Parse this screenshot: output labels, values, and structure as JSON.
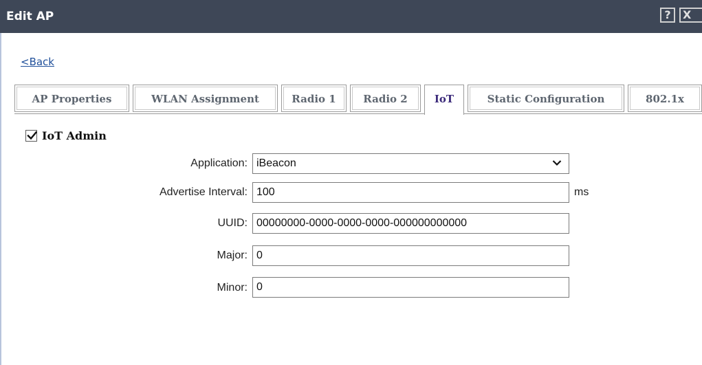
{
  "dialog": {
    "title": "Edit AP",
    "help_label": "?",
    "close_label": "X"
  },
  "back_link": "<Back",
  "tabs": [
    {
      "label": "AP Properties",
      "active": false
    },
    {
      "label": "WLAN Assignment",
      "active": false
    },
    {
      "label": "Radio 1",
      "active": false
    },
    {
      "label": "Radio 2",
      "active": false
    },
    {
      "label": "IoT",
      "active": true
    },
    {
      "label": "Static Configuration",
      "active": false
    },
    {
      "label": "802.1x",
      "active": false
    }
  ],
  "iot_admin": {
    "label": "IoT Admin",
    "checked": true
  },
  "form": {
    "application": {
      "label": "Application:",
      "value": "iBeacon"
    },
    "advertise_interval": {
      "label": "Advertise Interval:",
      "value": "100",
      "unit": "ms"
    },
    "uuid": {
      "label": "UUID:",
      "value": "00000000-0000-0000-0000-000000000000"
    },
    "major": {
      "label": "Major:",
      "value": "0"
    },
    "minor": {
      "label": "Minor:",
      "value": "0"
    }
  },
  "colors": {
    "titlebar": "#3e4757",
    "active_tab": "#3b2a7a",
    "inactive_tab": "#5e6670",
    "link": "#1f4f9a"
  }
}
